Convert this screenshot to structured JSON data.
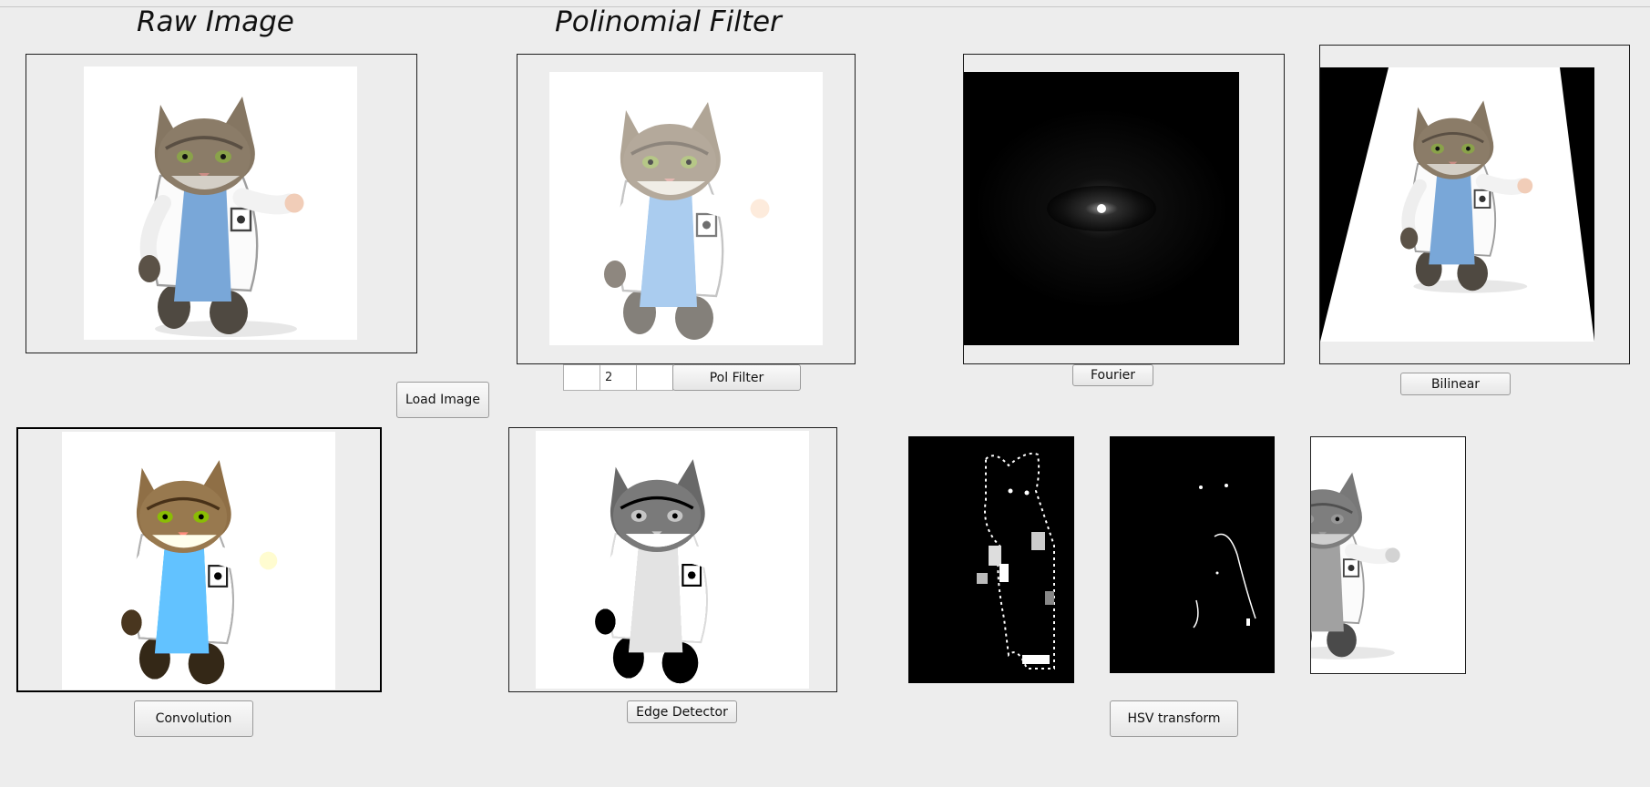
{
  "titles": {
    "raw": "Raw Image",
    "polynomial": "Polinomial Filter"
  },
  "buttons": {
    "load_image": "Load Image",
    "pol_filter": "Pol Filter",
    "fourier": "Fourier",
    "bilinear": "Bilinear",
    "convolution": "Convolution",
    "edge_detector": "Edge Detector",
    "hsv_transform": "HSV transform"
  },
  "pol_filter_inputs": {
    "first": "",
    "second": "2",
    "third": ""
  },
  "images": {
    "raw": "cat-doctor-photo",
    "polynomial": "cat-doctor-polynomial-filtered",
    "fourier": "fourier-spectrum",
    "bilinear": "cat-doctor-bilinear-warp",
    "convolution": "cat-doctor-convolution",
    "edge": "cat-doctor-edges",
    "hsv_mask_1": "hsv-mask-1",
    "hsv_mask_2": "hsv-mask-2",
    "grayscale": "cat-doctor-grayscale"
  }
}
